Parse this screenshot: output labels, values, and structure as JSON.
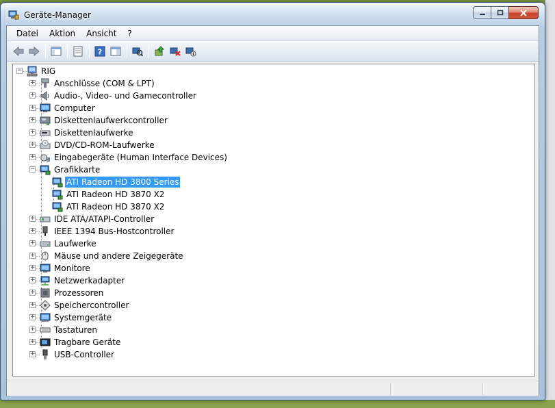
{
  "window": {
    "title": "Geräte-Manager",
    "controls": {
      "minimize": "minimize",
      "maximize": "maximize",
      "close": "close"
    }
  },
  "menu": [
    {
      "label": "Datei"
    },
    {
      "label": "Aktion"
    },
    {
      "label": "Ansicht"
    },
    {
      "label": "?"
    }
  ],
  "toolbar": {
    "buttons": [
      {
        "icon": "back-arrow-icon"
      },
      {
        "icon": "forward-arrow-icon"
      },
      {
        "icon": "show-hide-console-tree-icon"
      },
      {
        "icon": "properties-icon"
      },
      {
        "icon": "help-icon"
      },
      {
        "icon": "show-action-pane-icon"
      },
      {
        "icon": "scan-hardware-icon"
      },
      {
        "icon": "update-driver-icon"
      },
      {
        "icon": "uninstall-device-icon"
      },
      {
        "icon": "disable-device-icon"
      }
    ]
  },
  "tree": {
    "root": {
      "label": "RIG",
      "icon": "computer-network-icon"
    },
    "categories": [
      {
        "label": "Anschlüsse (COM & LPT)",
        "icon": "port-icon",
        "expanded": false
      },
      {
        "label": "Audio-, Video- und Gamecontroller",
        "icon": "speaker-icon",
        "expanded": false
      },
      {
        "label": "Computer",
        "icon": "monitor-icon",
        "expanded": false
      },
      {
        "label": "Diskettenlaufwerkcontroller",
        "icon": "floppy-controller-icon",
        "expanded": false
      },
      {
        "label": "Diskettenlaufwerke",
        "icon": "floppy-drive-icon",
        "expanded": false
      },
      {
        "label": "DVD/CD-ROM-Laufwerke",
        "icon": "dvd-drive-icon",
        "expanded": false
      },
      {
        "label": "Eingabegeräte (Human Interface Devices)",
        "icon": "hid-icon",
        "expanded": false
      },
      {
        "label": "Grafikkarte",
        "icon": "display-adapter-icon",
        "expanded": true,
        "children": [
          {
            "label": "ATI Radeon HD 3800 Series",
            "icon": "display-adapter-icon",
            "selected": true
          },
          {
            "label": "ATI Radeon HD 3870 X2",
            "icon": "display-adapter-icon",
            "selected": false
          },
          {
            "label": "ATI Radeon HD 3870 X2",
            "icon": "display-adapter-icon",
            "selected": false
          }
        ]
      },
      {
        "label": "IDE ATA/ATAPI-Controller",
        "icon": "ide-controller-icon",
        "expanded": false
      },
      {
        "label": "IEEE 1394 Bus-Hostcontroller",
        "icon": "firewire-icon",
        "expanded": false
      },
      {
        "label": "Laufwerke",
        "icon": "disk-drive-icon",
        "expanded": false
      },
      {
        "label": "Mäuse und andere Zeigegeräte",
        "icon": "mouse-icon",
        "expanded": false
      },
      {
        "label": "Monitore",
        "icon": "monitor-icon",
        "expanded": false
      },
      {
        "label": "Netzwerkadapter",
        "icon": "network-adapter-icon",
        "expanded": false
      },
      {
        "label": "Prozessoren",
        "icon": "processor-icon",
        "expanded": false
      },
      {
        "label": "Speichercontroller",
        "icon": "storage-controller-icon",
        "expanded": false
      },
      {
        "label": "Systemgeräte",
        "icon": "system-device-icon",
        "expanded": false
      },
      {
        "label": "Tastaturen",
        "icon": "keyboard-icon",
        "expanded": false
      },
      {
        "label": "Tragbare Geräte",
        "icon": "portable-device-icon",
        "expanded": false
      },
      {
        "label": "USB-Controller",
        "icon": "usb-icon",
        "expanded": false
      }
    ]
  },
  "colors": {
    "selection": "#3399ff",
    "title_glass": "#b7cde3",
    "close_button": "#c8432a"
  }
}
